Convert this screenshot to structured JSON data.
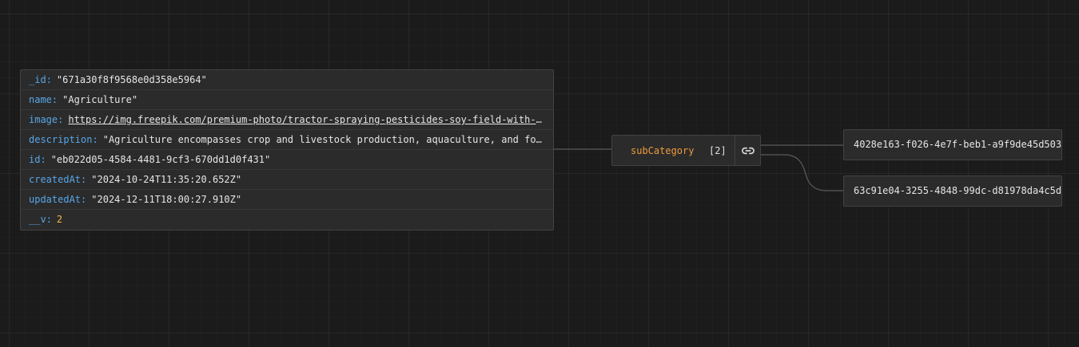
{
  "object_node": {
    "rows": [
      {
        "key": "_id",
        "value": "\"671a30f8f9568e0d358e5964\""
      },
      {
        "key": "name",
        "value": "\"Agriculture\""
      },
      {
        "key": "image",
        "value": "https://img.freepik.com/premium-photo/tractor-spraying-pesticides-soy-field-with-spra…"
      },
      {
        "key": "description",
        "value": "\"Agriculture encompasses crop and livestock production, aquaculture, and forest…"
      },
      {
        "key": "id",
        "value": "\"eb022d05-4584-4481-9cf3-670dd1d0f431\""
      },
      {
        "key": "createdAt",
        "value": "\"2024-10-24T11:35:20.652Z\""
      },
      {
        "key": "updatedAt",
        "value": "\"2024-12-11T18:00:27.910Z\""
      },
      {
        "key": "__v",
        "value": "2"
      }
    ]
  },
  "sub_node": {
    "label": "subCategory",
    "count": "[2]",
    "link_icon": "link-icon"
  },
  "leaf_nodes": [
    {
      "value": "4028e163-f026-4e7f-beb1-a9f9de45d503"
    },
    {
      "value": "63c91e04-3255-4848-99dc-d81978da4c5d"
    }
  ],
  "colors": {
    "background": "#1b1b1b",
    "node_bg": "#2b2b2b",
    "node_border": "#424242",
    "key": "#58a6e8",
    "string": "#e6e6e6",
    "number": "#f5b845",
    "sub_label": "#f09a3e",
    "edge": "#5a5a5a"
  }
}
